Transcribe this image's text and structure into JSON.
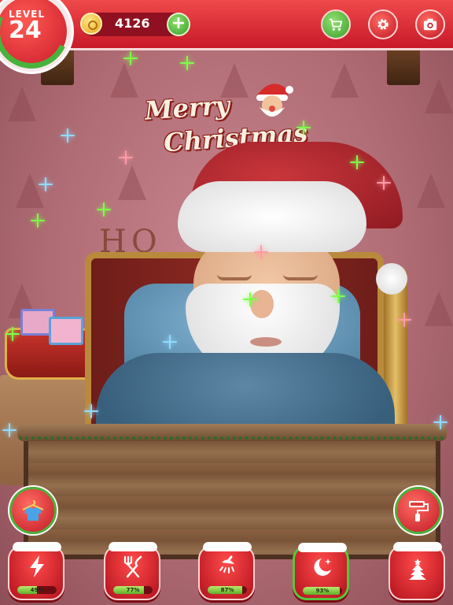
{
  "hud": {
    "level_label": "LEVEL",
    "level_value": "24",
    "level_progress": 0.3,
    "coins": "4126",
    "add_coins_label": "+"
  },
  "scene": {
    "sign_line1": "Merry",
    "sign_line2": "Christmas",
    "wall_letters": "HO"
  },
  "needs": [
    {
      "name": "energy",
      "icon": "lightning-icon",
      "percent_label": "49%",
      "value": 0.49
    },
    {
      "name": "food",
      "icon": "fork-knife-icon",
      "percent_label": "77%",
      "value": 0.77
    },
    {
      "name": "hygiene",
      "icon": "shower-icon",
      "percent_label": "87%",
      "value": 0.87
    },
    {
      "name": "sleep",
      "icon": "moon-stars-icon",
      "percent_label": "93%",
      "value": 0.93
    },
    {
      "name": "decorate",
      "icon": "christmas-tree-icon"
    }
  ],
  "side_buttons": [
    {
      "name": "outfit",
      "icon": "hanger-shirt-icon"
    },
    {
      "name": "paint",
      "icon": "paint-roller-icon"
    }
  ],
  "top_buttons": [
    {
      "name": "shop",
      "icon": "cart-icon"
    },
    {
      "name": "settings",
      "icon": "gear-icon"
    },
    {
      "name": "camera",
      "icon": "camera-icon"
    }
  ],
  "colors": {
    "hud_red": "#c8192a",
    "button_green": "#3b9e2a",
    "sparkle_green": "#7dff4a",
    "sparkle_blue": "#8fdcff"
  }
}
